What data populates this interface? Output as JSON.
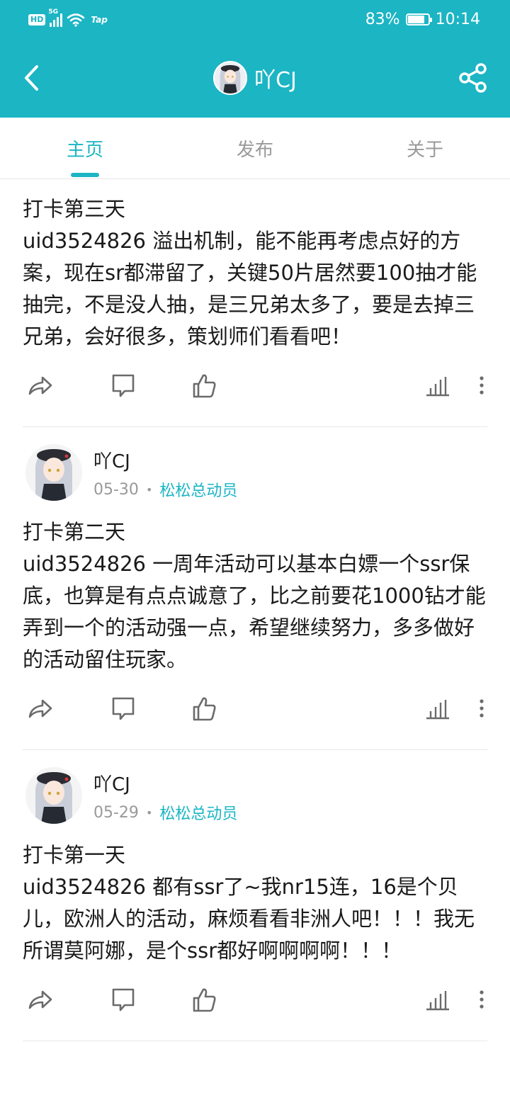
{
  "status_bar": {
    "hd": "HD",
    "network": "5G",
    "wifi_extra": "Tap",
    "battery_percent": "83%",
    "battery_level": 0.83,
    "time": "10:14"
  },
  "header": {
    "title": "吖CJ",
    "back_icon": "chevron-left-icon",
    "share_icon": "share-icon"
  },
  "tabs": [
    {
      "label": "主页",
      "active": true
    },
    {
      "label": "发布",
      "active": false
    },
    {
      "label": "关于",
      "active": false
    }
  ],
  "posts": [
    {
      "show_header": false,
      "title": "打卡第三天",
      "body": "uid3524826 溢出机制，能不能再考虑点好的方案，现在sr都滞留了，关键50片居然要100抽才能抽完，不是没人抽，是三兄弟太多了，要是去掉三兄弟，会好很多，策划师们看看吧！"
    },
    {
      "show_header": true,
      "author": "吖CJ",
      "date": "05-30",
      "badge": "松松总动员",
      "title": "打卡第二天",
      "body": "uid3524826 一周年活动可以基本白嫖一个ssr保底，也算是有点点诚意了，比之前要花1000钻才能弄到一个的活动强一点，希望继续努力，多多做好的活动留住玩家。"
    },
    {
      "show_header": true,
      "author": "吖CJ",
      "date": "05-29",
      "badge": "松松总动员",
      "title": "打卡第一天",
      "body": "uid3524826 都有ssr了~我nr15连，16是个贝儿，欧洲人的活动，麻烦看看非洲人吧！！！我无所谓莫阿娜，是个ssr都好啊啊啊啊！！！"
    }
  ],
  "colors": {
    "accent": "#1bb5c4",
    "text": "#1a1a1a",
    "muted": "#999999"
  }
}
